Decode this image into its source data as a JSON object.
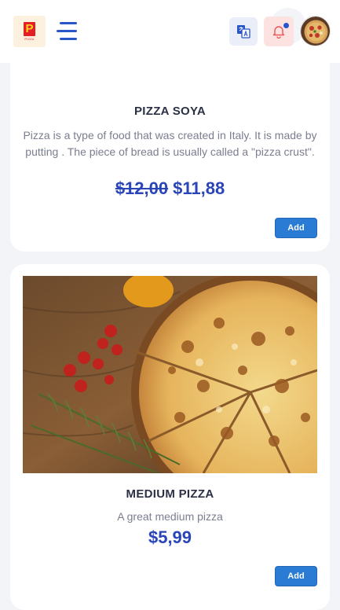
{
  "header": {
    "logo": {
      "mark": "P",
      "sub": "PIZZA"
    },
    "icons": {
      "menu": "hamburger-menu-icon",
      "language": "translate-icon",
      "notifications": "bell-icon",
      "avatar": "pizza-avatar"
    }
  },
  "products": [
    {
      "name": "PIZZA SOYA",
      "description": "Pizza is a type of food that was created in Italy. It is made by putting . The piece of bread is usually called a \"pizza crust\".",
      "old_price": "$12,00",
      "price": "$11,88",
      "add_label": "Add"
    },
    {
      "name": "MEDIUM PIZZA",
      "description": "A great medium pizza",
      "price": "$5,99",
      "add_label": "Add"
    }
  ],
  "colors": {
    "accent": "#2a45b8",
    "button": "#2a7bd3",
    "notification_bg": "#fde2e2",
    "language_bg": "#e9eef9"
  }
}
